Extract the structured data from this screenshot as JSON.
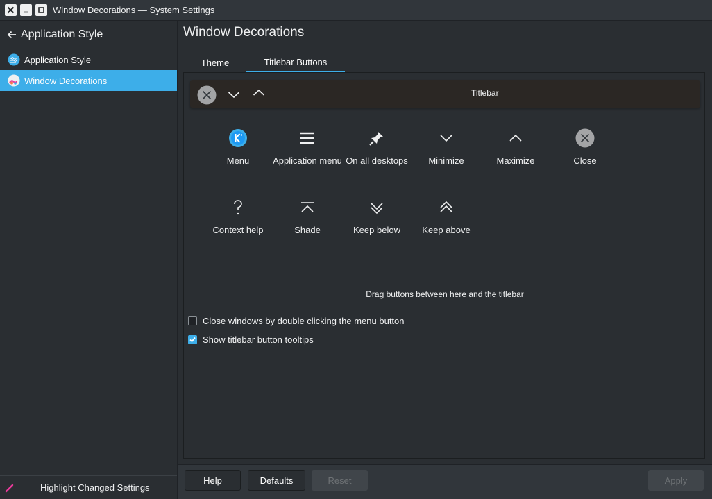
{
  "window": {
    "title": "Window Decorations — System Settings",
    "buttons": [
      "close-icon",
      "minimize-icon",
      "maximize-icon"
    ]
  },
  "sidebar": {
    "header_title": "Application Style",
    "items": [
      {
        "label": "Application Style",
        "icon": "application-style-icon",
        "active": false
      },
      {
        "label": "Window Decorations",
        "icon": "window-decorations-icon",
        "active": true
      }
    ],
    "footer_label": "Highlight Changed Settings"
  },
  "main": {
    "title": "Window Decorations",
    "tabs": [
      {
        "label": "Theme",
        "active": false
      },
      {
        "label": "Titlebar Buttons",
        "active": true
      }
    ],
    "titlebar_preview": {
      "label": "Titlebar",
      "buttons": [
        "close-icon",
        "minimize-icon",
        "maximize-icon"
      ]
    },
    "available_buttons": [
      {
        "label": "Menu",
        "icon": "kde-menu-icon"
      },
      {
        "label": "Application menu",
        "icon": "hamburger-menu-icon"
      },
      {
        "label": "On all desktops",
        "icon": "pin-icon"
      },
      {
        "label": "Minimize",
        "icon": "minimize-icon"
      },
      {
        "label": "Maximize",
        "icon": "maximize-icon"
      },
      {
        "label": "Close",
        "icon": "close-icon"
      },
      {
        "label": "Context help",
        "icon": "question-icon"
      },
      {
        "label": "Shade",
        "icon": "shade-icon"
      },
      {
        "label": "Keep below",
        "icon": "keep-below-icon"
      },
      {
        "label": "Keep above",
        "icon": "keep-above-icon"
      }
    ],
    "drag_hint": "Drag buttons between here and the titlebar",
    "options": [
      {
        "label": "Close windows by double clicking the menu button",
        "checked": false
      },
      {
        "label": "Show titlebar button tooltips",
        "checked": true
      }
    ]
  },
  "bottom_bar": {
    "help": "Help",
    "defaults": "Defaults",
    "reset": "Reset",
    "apply": "Apply"
  },
  "colors": {
    "accent": "#3daee9",
    "background": "#2a2e32",
    "pink": "#e93a9a"
  }
}
